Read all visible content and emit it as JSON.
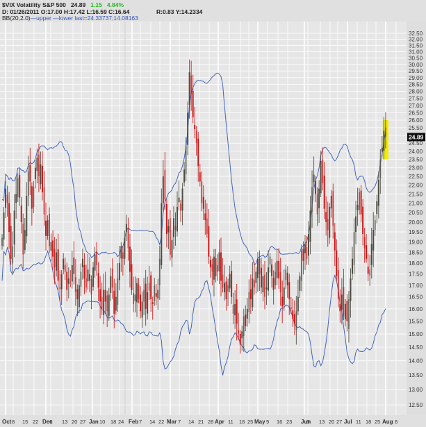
{
  "header": {
    "symbol": "$VIX Volatility S&P 500",
    "last": "24.89",
    "change": "1.15",
    "change_pct": "4.84%",
    "ohlc_readout": "D: 01/26/2011 O:17.00 H:17.42 L:16.59 C:16.64",
    "cursor_readout": "R:0.83  Y:14.2334",
    "indicator_name": "BB(20,2.0)",
    "indicator_legend": "—upper —lower last=24.33737;14.08163"
  },
  "colors": {
    "up": "#4a4a40",
    "down": "#cc1111",
    "band": "#4466bb",
    "highlight": "#eeee00",
    "positive": "#22bb22"
  },
  "chart_data": {
    "type": "candlestick",
    "title": "$VIX Volatility S&P 500",
    "yscale": "log",
    "ylim": [
      12.25,
      33.0
    ],
    "y_ticks": [
      "32.50",
      "32.00",
      "31.50",
      "31.00",
      "30.50",
      "30.00",
      "29.50",
      "29.00",
      "28.50",
      "28.00",
      "27.50",
      "27.00",
      "26.50",
      "26.00",
      "25.50",
      "25.00",
      "24.50",
      "24.00",
      "23.50",
      "23.00",
      "22.50",
      "22.00",
      "21.50",
      "21.00",
      "20.50",
      "20.00",
      "19.50",
      "19.00",
      "18.50",
      "18.00",
      "17.50",
      "17.00",
      "16.50",
      "16.00",
      "15.50",
      "15.00",
      "14.50",
      "14.00",
      "13.50",
      "13.00",
      "12.50"
    ],
    "x_ticks": [
      {
        "label": "Oct",
        "major": true
      },
      {
        "label": "8"
      },
      {
        "label": "15"
      },
      {
        "label": "22"
      },
      {
        "label": "Dec",
        "major": true
      },
      {
        "label": "6"
      },
      {
        "label": "13"
      },
      {
        "label": "20"
      },
      {
        "label": "27"
      },
      {
        "label": "Jan",
        "major": true
      },
      {
        "label": "10"
      },
      {
        "label": "18"
      },
      {
        "label": "24"
      },
      {
        "label": "Feb",
        "major": true
      },
      {
        "label": "7"
      },
      {
        "label": "14"
      },
      {
        "label": "22"
      },
      {
        "label": "Mar",
        "major": true
      },
      {
        "label": "7"
      },
      {
        "label": "14"
      },
      {
        "label": "21"
      },
      {
        "label": "28"
      },
      {
        "label": "Apr",
        "major": true
      },
      {
        "label": "11"
      },
      {
        "label": "18"
      },
      {
        "label": "25"
      },
      {
        "label": "May",
        "major": true
      },
      {
        "label": "9"
      },
      {
        "label": "16"
      },
      {
        "label": "23"
      },
      {
        "label": "Jun",
        "major": true
      },
      {
        "label": "6"
      },
      {
        "label": "13"
      },
      {
        "label": "20"
      },
      {
        "label": "27"
      },
      {
        "label": "Jul",
        "major": true
      },
      {
        "label": "11"
      },
      {
        "label": "18"
      },
      {
        "label": "25"
      },
      {
        "label": "Aug",
        "major": true
      },
      {
        "label": "8"
      }
    ],
    "last_price_label": "24.89",
    "bollinger": {
      "period": 20,
      "stddev": 2.0,
      "last_upper": 24.33737,
      "last_lower": 14.08163
    },
    "closes": [
      19.2,
      20.5,
      21.8,
      21.0,
      19.5,
      18.2,
      18.8,
      20.6,
      21.5,
      22.4,
      21.3,
      20.0,
      18.4,
      19.6,
      21.4,
      22.8,
      22.2,
      20.7,
      21.9,
      23.0,
      23.6,
      22.5,
      23.2,
      21.6,
      20.4,
      19.3,
      20.1,
      18.8,
      19.0,
      18.3,
      17.8,
      18.5,
      17.2,
      16.9,
      17.5,
      18.2,
      17.6,
      16.8,
      17.3,
      17.1,
      17.9,
      17.5,
      16.7,
      16.4,
      17.0,
      17.6,
      18.2,
      17.3,
      16.9,
      17.7,
      17.2,
      16.6,
      17.8,
      18.4,
      17.9,
      16.9,
      16.3,
      16.0,
      16.8,
      16.3,
      15.9,
      16.6,
      17.4,
      16.9,
      15.8,
      16.5,
      17.3,
      18.0,
      18.8,
      18.2,
      19.2,
      19.9,
      18.7,
      17.6,
      16.8,
      16.2,
      16.6,
      17.1,
      16.4,
      15.9,
      16.3,
      16.8,
      16.0,
      16.7,
      17.1,
      16.4,
      16.2,
      17.0,
      16.5,
      16.8,
      18.2,
      21.0,
      22.5,
      21.2,
      19.4,
      19.8,
      18.4,
      19.1,
      20.2,
      19.6,
      20.8,
      21.3,
      20.6,
      21.8,
      22.9,
      24.3,
      26.5,
      29.4,
      27.8,
      26.2,
      25.4,
      24.5,
      23.1,
      22.2,
      21.0,
      20.7,
      20.1,
      19.4,
      18.3,
      17.8,
      17.6,
      18.3,
      17.4,
      17.9,
      18.5,
      17.2,
      16.9,
      17.1,
      16.4,
      17.0,
      17.5,
      16.5,
      15.8,
      16.2,
      15.4,
      15.0,
      14.6,
      15.1,
      15.7,
      15.3,
      16.0,
      16.7,
      16.4,
      17.3,
      16.9,
      17.6,
      18.2,
      17.5,
      16.9,
      17.4,
      16.5,
      16.9,
      17.8,
      18.3,
      17.4,
      16.8,
      17.6,
      18.1,
      17.3,
      16.7,
      16.1,
      16.9,
      17.7,
      17.0,
      16.4,
      16.0,
      15.6,
      15.4,
      15.9,
      16.5,
      17.4,
      18.6,
      18.1,
      18.9,
      18.2,
      19.4,
      20.6,
      21.9,
      22.6,
      21.5,
      20.4,
      21.8,
      23.4,
      22.1,
      20.7,
      20.0,
      19.6,
      20.8,
      21.4,
      19.8,
      18.6,
      17.4,
      16.4,
      15.9,
      16.6,
      15.7,
      16.2,
      15.5,
      16.4,
      17.3,
      18.2,
      19.5,
      20.3,
      20.9,
      21.6,
      20.4,
      19.4,
      18.7,
      18.2,
      17.5,
      17.7,
      18.9,
      19.6,
      20.1,
      21.1,
      22.3,
      23.5,
      24.2,
      25.3,
      24.89
    ]
  }
}
